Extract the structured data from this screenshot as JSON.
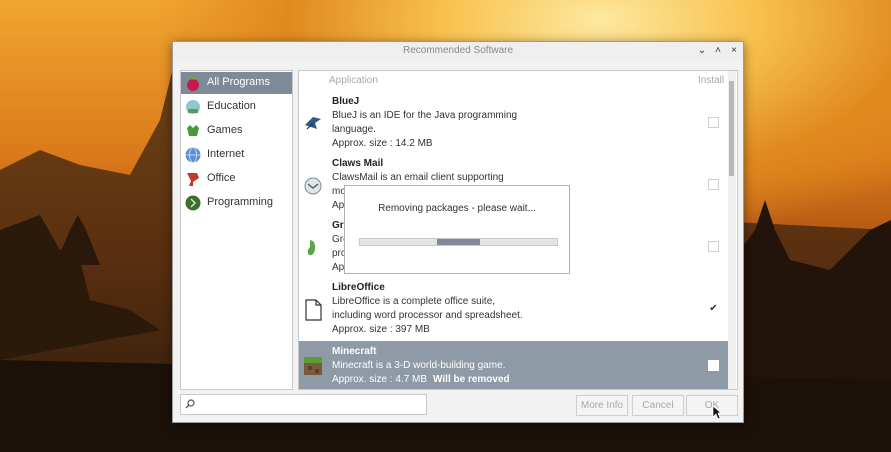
{
  "window": {
    "title": "Recommended Software",
    "minimize_glyph": "⌄",
    "maximize_glyph": "˄",
    "close_glyph": "×"
  },
  "sidebar": {
    "items": [
      {
        "label": "All Programs",
        "icon": "raspberry-icon",
        "selected": true
      },
      {
        "label": "Education",
        "icon": "education-icon",
        "selected": false
      },
      {
        "label": "Games",
        "icon": "games-icon",
        "selected": false
      },
      {
        "label": "Internet",
        "icon": "globe-icon",
        "selected": false
      },
      {
        "label": "Office",
        "icon": "office-icon",
        "selected": false
      },
      {
        "label": "Programming",
        "icon": "programming-icon",
        "selected": false
      }
    ]
  },
  "list": {
    "header_application": "Application",
    "header_install": "Install",
    "rows": [
      {
        "name": "BlueJ",
        "line1": "BlueJ is an IDE for the Java programming",
        "line2": "language.",
        "line3": "Approx. size : 14.2 MB",
        "checked": false
      },
      {
        "name": "Claws Mail",
        "line1": "ClawsMail is an email client supporting",
        "line2": "mo",
        "line3": "Appr",
        "checked": false
      },
      {
        "name": "Gre",
        "line1": "Gre",
        "line2": "pro",
        "line3": "App",
        "checked": false
      },
      {
        "name": "LibreOffice",
        "line1": "LibreOffice is a complete office suite,",
        "line2": "including word processor and spreadsheet.",
        "line3": "Approx. size : 397 MB",
        "checked": true,
        "check_glyph": "✔"
      },
      {
        "name": "Minecraft",
        "line1": "Minecraft is a 3-D world-building game.",
        "line2": "Approx. size : 4.7 MB",
        "line2_bold": "Will be removed",
        "checked": false
      }
    ]
  },
  "search": {
    "icon": "search-icon",
    "value": ""
  },
  "buttons": {
    "more_info": "More Info",
    "cancel": "Cancel",
    "ok": "OK"
  },
  "modal": {
    "message": "Removing packages - please wait...",
    "progress": 0.5
  }
}
